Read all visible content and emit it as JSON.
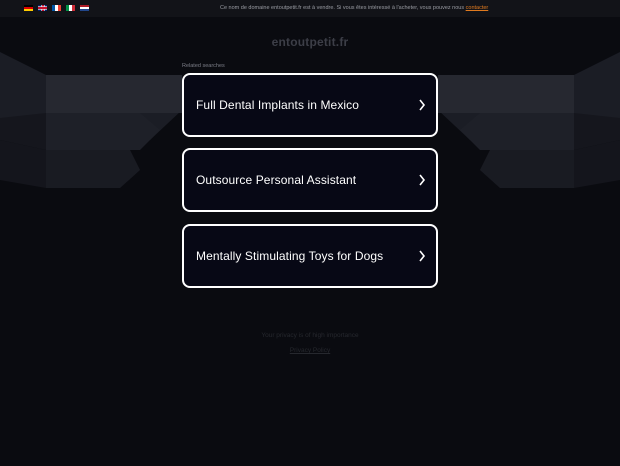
{
  "topbar": {
    "languages": [
      "de",
      "en",
      "fr",
      "it",
      "nl"
    ],
    "notice_text": "Ce nom de domaine entoutpetit.fr est à vendre. Si vous êtes intéressé à l'acheter, vous pouvez nous ",
    "notice_link": "contacter"
  },
  "header": {
    "domain": "entoutpetit.fr"
  },
  "main": {
    "related_label": "Related searches",
    "results": [
      {
        "label": "Full Dental Implants in Mexico"
      },
      {
        "label": "Outsource Personal Assistant"
      },
      {
        "label": "Mentally Stimulating Toys for Dogs"
      }
    ]
  },
  "footer": {
    "privacy_text": "Your privacy is of high importance",
    "privacy_link": "Privacy Policy"
  },
  "colors": {
    "background": "#0a0b10",
    "card_border": "#ffffff",
    "card_fill": "#070815",
    "link_accent": "#e07a1f"
  }
}
